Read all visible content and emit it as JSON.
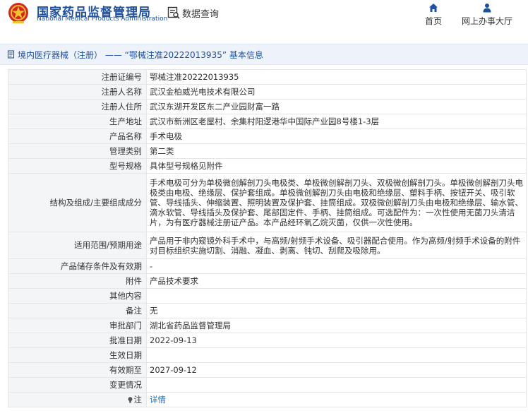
{
  "header": {
    "site_title": "国家药品监督管理局",
    "site_subtitle": "National Medical Products Administration",
    "module_label": "数据查询",
    "nav": [
      {
        "label": "首页",
        "icon": "home-icon"
      },
      {
        "label": "网上办事大厅",
        "icon": "person-icon"
      }
    ]
  },
  "breadcrumb": {
    "text": "境内医疗器械（注册） —— “鄂械注准20222013935” 基本信息",
    "icon": "document-icon"
  },
  "rows": [
    {
      "label": "注册证编号",
      "value": "鄂械注准20222013935"
    },
    {
      "label": "注册人名称",
      "value": "武汉金柏威光电技术有限公司"
    },
    {
      "label": "注册人住所",
      "value": "武汉东湖开发区东二产业园财富一路"
    },
    {
      "label": "生产地址",
      "value": "武汉市新洲区老屋村、余集村阳逻港华中国际产业园8号楼1-3层"
    },
    {
      "label": "产品名称",
      "value": "手术电极"
    },
    {
      "label": "管理类别",
      "value": "第二类"
    },
    {
      "label": "型号规格",
      "value": "具体型号规格见附件"
    },
    {
      "label": "结构及组成/主要组成成分",
      "value": "手术电极可分为单极微创解剖刀头电极类、单极微创解剖刀头、双极微创解剖刀头。单极微创解剖刀头电极类由电极、绝缘层、保护套组成。单极微创解剖刀头由电极和绝缘层、塑料手柄、按钮开关、吸引软管、导线插头、伸缩装置、照明装置及保护套、挂筒组成。双极微创解剖刀头由电极和绝缘层、输水管、滴水软管、导线插头及保护套、尾部固定件、手柄、挂筒组成。可选配件为：一次性使用无菌刀头清洁片，为有医疗器械注册证产品。本产品经环氧乙烷灭菌，仅供一次性使用。"
    },
    {
      "label": "适用范围/预期用途",
      "value": "产品用于非内窥镜外科手术中，与高频/射频手术设备、吸引器配合使用。作为高频/射频手术设备的附件对目标组织实施切割、消融、凝血、剥离、钝切、刮爬及吸除用。"
    },
    {
      "label": "产品储存条件及有效期",
      "value": "-"
    },
    {
      "label": "附件",
      "value": "产品技术要求"
    },
    {
      "label": "其他内容",
      "value": ""
    },
    {
      "label": "备注",
      "value": "无"
    },
    {
      "label": "审批部门",
      "value": "湖北省药品监督管理局"
    },
    {
      "label": "批准日期",
      "value": "2022-09-13"
    },
    {
      "label": "生效日期",
      "value": ""
    },
    {
      "label": "有效期至",
      "value": "2027-09-12"
    },
    {
      "label": "变更情况",
      "value": ""
    },
    {
      "label": "注",
      "value": "详情",
      "icon": "lightbulb-icon"
    }
  ]
}
